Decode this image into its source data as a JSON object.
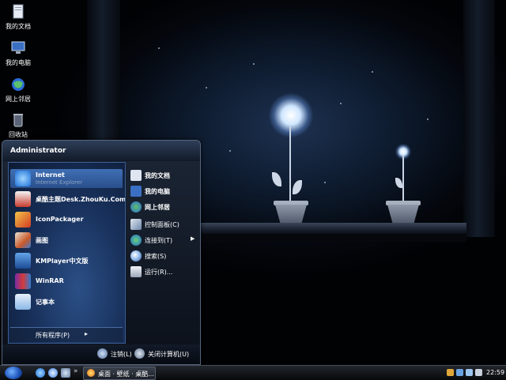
{
  "desktop": {
    "icons": [
      {
        "label": "我的文档",
        "icon": "documents-icon"
      },
      {
        "label": "我的电脑",
        "icon": "computer-icon"
      },
      {
        "label": "网上邻居",
        "icon": "network-icon"
      },
      {
        "label": "回收站",
        "icon": "recycle-bin-icon"
      }
    ]
  },
  "start_menu": {
    "user": "Administrator",
    "programs": [
      {
        "name": "Internet",
        "sub": "Internet Explorer",
        "icon": "ie-icon"
      },
      {
        "name": "桌酷主题Desk.ZhouKu.Com",
        "icon": "theme-icon"
      },
      {
        "name": "IconPackager",
        "icon": "iconpackager-icon"
      },
      {
        "name": "画图",
        "icon": "paint-icon"
      },
      {
        "name": "KMPlayer中文版",
        "icon": "kmplayer-icon"
      },
      {
        "name": "WinRAR",
        "icon": "winrar-icon"
      },
      {
        "name": "记事本",
        "icon": "notepad-icon"
      }
    ],
    "all_programs": "所有程序(P)",
    "places": [
      {
        "label": "我的文档",
        "icon": "documents-icon"
      },
      {
        "label": "我的电脑",
        "icon": "computer-icon"
      },
      {
        "label": "网上邻居",
        "icon": "network-icon"
      },
      {
        "label": "控制面板(C)",
        "icon": "control-panel-icon"
      },
      {
        "label": "连接到(T)",
        "icon": "connect-icon"
      },
      {
        "label": "搜索(S)",
        "icon": "search-icon"
      },
      {
        "label": "运行(R)...",
        "icon": "run-icon"
      }
    ],
    "logoff": "注销(L)",
    "shutdown": "关闭计算机(U)"
  },
  "taskbar": {
    "task_label": "桌面 · 壁纸 · 桌酷...",
    "clock": "22:59",
    "more": "»"
  }
}
